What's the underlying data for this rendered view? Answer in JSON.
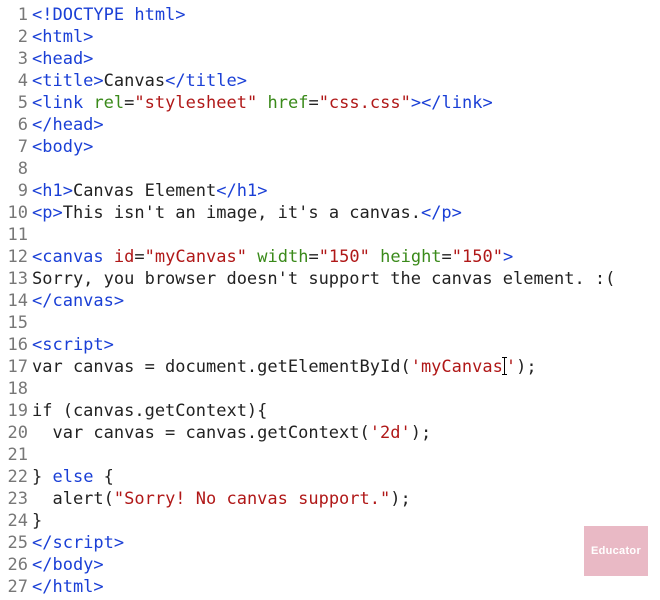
{
  "editor": {
    "cursor_style": "i-beam",
    "watermark": "Educator",
    "lines": [
      {
        "n": 1,
        "t": [
          {
            "c": "tag",
            "v": "<!DOCTYPE html>"
          }
        ]
      },
      {
        "n": 2,
        "t": [
          {
            "c": "tag",
            "v": "<html>"
          }
        ]
      },
      {
        "n": 3,
        "t": [
          {
            "c": "tag",
            "v": "<head>"
          }
        ]
      },
      {
        "n": 4,
        "t": [
          {
            "c": "tag",
            "v": "<title>"
          },
          {
            "c": "text",
            "v": "Canvas"
          },
          {
            "c": "tag",
            "v": "</title>"
          }
        ]
      },
      {
        "n": 5,
        "t": [
          {
            "c": "tag",
            "v": "<link"
          },
          {
            "c": "text",
            "v": " "
          },
          {
            "c": "attr-green",
            "v": "rel"
          },
          {
            "c": "punct",
            "v": "="
          },
          {
            "c": "string",
            "v": "\"stylesheet\""
          },
          {
            "c": "text",
            "v": " "
          },
          {
            "c": "attr-green",
            "v": "href"
          },
          {
            "c": "punct",
            "v": "="
          },
          {
            "c": "string",
            "v": "\"css.css\""
          },
          {
            "c": "tag",
            "v": ">"
          },
          {
            "c": "tag",
            "v": "</link>"
          }
        ]
      },
      {
        "n": 6,
        "t": [
          {
            "c": "tag",
            "v": "</head>"
          }
        ]
      },
      {
        "n": 7,
        "t": [
          {
            "c": "tag",
            "v": "<body>"
          }
        ]
      },
      {
        "n": 8,
        "t": []
      },
      {
        "n": 9,
        "t": [
          {
            "c": "tag",
            "v": "<h1>"
          },
          {
            "c": "text",
            "v": "Canvas Element"
          },
          {
            "c": "tag",
            "v": "</h1>"
          }
        ]
      },
      {
        "n": 10,
        "t": [
          {
            "c": "tag",
            "v": "<p>"
          },
          {
            "c": "text",
            "v": "This isn't an image, it's a canvas."
          },
          {
            "c": "tag",
            "v": "</p>"
          }
        ]
      },
      {
        "n": 11,
        "t": []
      },
      {
        "n": 12,
        "t": [
          {
            "c": "tag",
            "v": "<canvas"
          },
          {
            "c": "text",
            "v": " "
          },
          {
            "c": "attr-red",
            "v": "id"
          },
          {
            "c": "punct",
            "v": "="
          },
          {
            "c": "string",
            "v": "\"myCanvas\""
          },
          {
            "c": "text",
            "v": " "
          },
          {
            "c": "attr-green",
            "v": "width"
          },
          {
            "c": "punct",
            "v": "="
          },
          {
            "c": "string",
            "v": "\"150\""
          },
          {
            "c": "text",
            "v": " "
          },
          {
            "c": "attr-green",
            "v": "height"
          },
          {
            "c": "punct",
            "v": "="
          },
          {
            "c": "string",
            "v": "\"150\""
          },
          {
            "c": "tag",
            "v": ">"
          }
        ]
      },
      {
        "n": 13,
        "t": [
          {
            "c": "text",
            "v": "Sorry, you browser doesn't support the canvas element. :("
          }
        ]
      },
      {
        "n": 14,
        "t": [
          {
            "c": "tag",
            "v": "</canvas>"
          }
        ]
      },
      {
        "n": 15,
        "t": []
      },
      {
        "n": 16,
        "t": [
          {
            "c": "tag",
            "v": "<script>"
          }
        ]
      },
      {
        "n": 17,
        "t": [
          {
            "c": "text",
            "v": "var canvas = document.getElementById("
          },
          {
            "c": "string",
            "v": "'myCanvas"
          },
          {
            "c": "cursor",
            "v": ""
          },
          {
            "c": "string",
            "v": "'"
          },
          {
            "c": "text",
            "v": ");"
          }
        ]
      },
      {
        "n": 18,
        "t": []
      },
      {
        "n": 19,
        "t": [
          {
            "c": "text",
            "v": "if (canvas.getContext){"
          }
        ]
      },
      {
        "n": 20,
        "t": [
          {
            "c": "text",
            "v": "  var canvas = canvas.getContext("
          },
          {
            "c": "string",
            "v": "'2d'"
          },
          {
            "c": "text",
            "v": ");"
          }
        ]
      },
      {
        "n": 21,
        "t": []
      },
      {
        "n": 22,
        "t": [
          {
            "c": "text",
            "v": "} "
          },
          {
            "c": "tag",
            "v": "else"
          },
          {
            "c": "text",
            "v": " {"
          }
        ]
      },
      {
        "n": 23,
        "t": [
          {
            "c": "text",
            "v": "  alert("
          },
          {
            "c": "string",
            "v": "\"Sorry! No canvas support.\""
          },
          {
            "c": "text",
            "v": ");"
          }
        ]
      },
      {
        "n": 24,
        "t": [
          {
            "c": "text",
            "v": "}"
          }
        ]
      },
      {
        "n": 25,
        "t": [
          {
            "c": "tag",
            "v": "</script>"
          }
        ]
      },
      {
        "n": 26,
        "t": [
          {
            "c": "tag",
            "v": "</body>"
          }
        ]
      },
      {
        "n": 27,
        "t": [
          {
            "c": "tag",
            "v": "</html>"
          }
        ]
      }
    ]
  }
}
